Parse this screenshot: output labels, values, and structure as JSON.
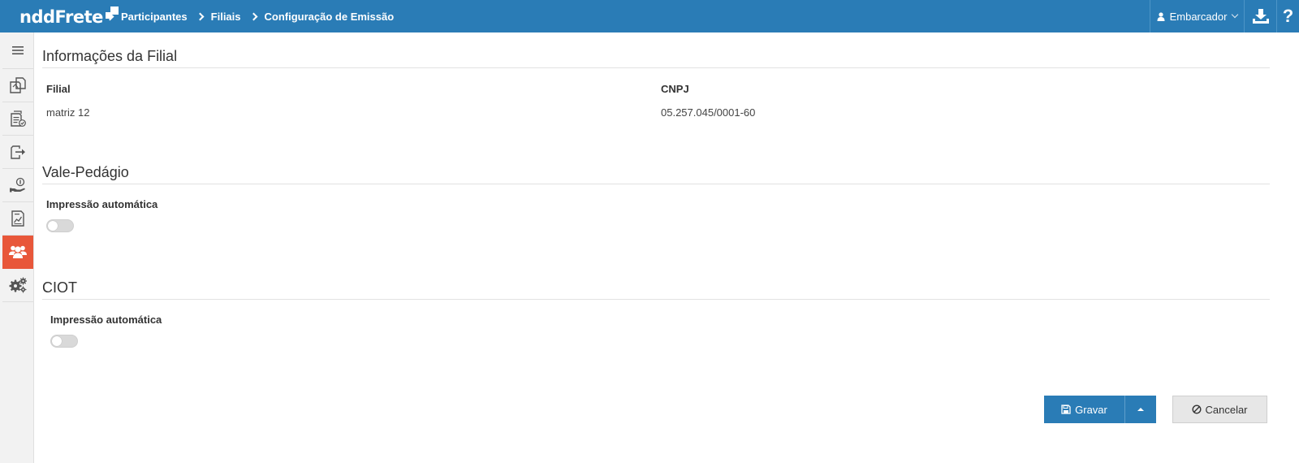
{
  "app": {
    "logo_text": "nddFrete"
  },
  "breadcrumb": [
    "Participantes",
    "Filiais",
    "Configuração de Emissão"
  ],
  "user_menu": {
    "label": "Embarcador"
  },
  "header": {
    "help_label": "?"
  },
  "sidebar": {
    "items": [
      {
        "icon": "hamburger-menu-icon"
      },
      {
        "icon": "documents-icon"
      },
      {
        "icon": "document-check-icon"
      },
      {
        "icon": "document-export-icon"
      },
      {
        "icon": "hand-coin-icon"
      },
      {
        "icon": "report-chart-icon"
      },
      {
        "icon": "users-icon",
        "active": true
      },
      {
        "icon": "gears-icon"
      }
    ]
  },
  "branch_info": {
    "title": "Informações da Filial",
    "filial_label": "Filial",
    "filial_value": "matriz 12",
    "cnpj_label": "CNPJ",
    "cnpj_value": "05.257.045/0001-60"
  },
  "vale_pedagio": {
    "title": "Vale-Pedágio",
    "auto_print_label": "Impressão automática",
    "auto_print_enabled": false
  },
  "ciot": {
    "title": "CIOT",
    "auto_print_label": "Impressão automática",
    "auto_print_enabled": false
  },
  "actions": {
    "save_label": "Gravar",
    "cancel_label": "Cancelar"
  },
  "colors": {
    "header": "#2a7cb6",
    "active_sidebar": "#e8573a",
    "save_button": "#2a7cb6"
  }
}
